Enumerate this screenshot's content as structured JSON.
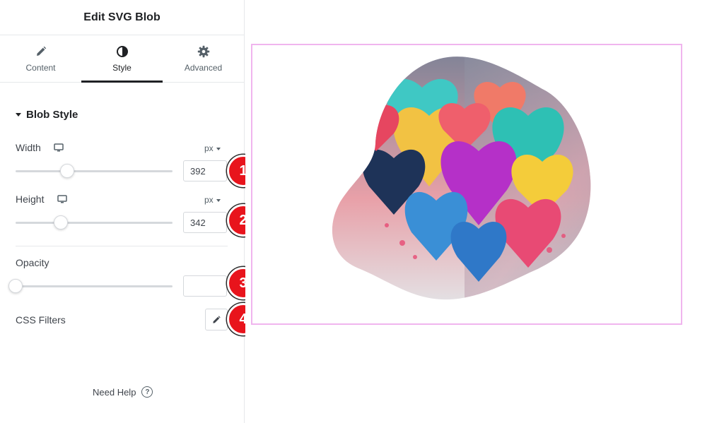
{
  "panel": {
    "title": "Edit SVG Blob",
    "tabs": [
      {
        "label": "Content",
        "icon": "pencil-icon",
        "active": false
      },
      {
        "label": "Style",
        "icon": "contrast-icon",
        "active": true
      },
      {
        "label": "Advanced",
        "icon": "gear-icon",
        "active": false
      }
    ],
    "section": {
      "title": "Blob Style",
      "expanded": true
    },
    "controls": {
      "width": {
        "label": "Width",
        "unit": "px",
        "value": "392",
        "slider_fraction": 0.33,
        "device_icon": "desktop-icon"
      },
      "height": {
        "label": "Height",
        "unit": "px",
        "value": "342",
        "slider_fraction": 0.29,
        "device_icon": "desktop-icon"
      },
      "opacity": {
        "label": "Opacity",
        "value": "",
        "slider_fraction": 0.0
      },
      "css_filters": {
        "label": "CSS Filters",
        "button_icon": "pencil-icon"
      }
    },
    "badges": [
      "1",
      "2",
      "3",
      "4"
    ],
    "help": {
      "label": "Need Help",
      "icon": "help-circle-icon"
    }
  },
  "colors": {
    "accent": "#1f2124",
    "badge": "#e8141c",
    "frame": "#f0b5ee",
    "border": "#d5d8dc"
  }
}
